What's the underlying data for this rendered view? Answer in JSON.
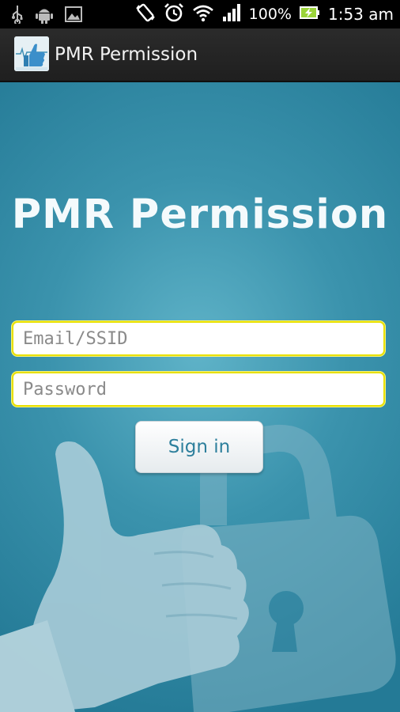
{
  "status_bar": {
    "battery_percent": "100%",
    "time": "1:53 am"
  },
  "action_bar": {
    "title": "PMR Permission"
  },
  "main": {
    "hero_title": "PMR Permission",
    "email": {
      "value": "",
      "placeholder": "Email/SSID"
    },
    "password": {
      "value": "",
      "placeholder": "Password"
    },
    "signin_label": "Sign in"
  },
  "colors": {
    "bg_teal": "#3b93ad",
    "field_border": "#e8e000",
    "button_text": "#2d7f9c"
  }
}
